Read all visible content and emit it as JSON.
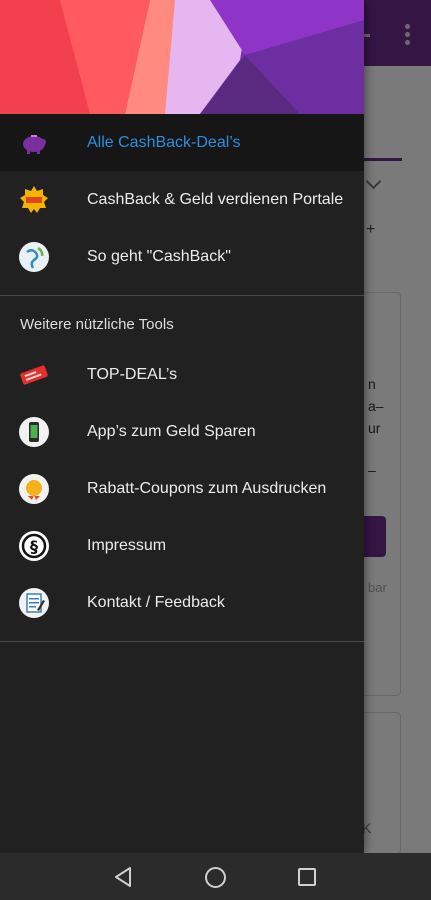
{
  "drawer": {
    "items_primary": [
      {
        "label": "Alle CashBack-Deal’s",
        "icon": "piggy-bank-icon",
        "active": true
      },
      {
        "label": "CashBack & Geld verdienen Portale",
        "icon": "new-badge-icon",
        "active": false
      },
      {
        "label": "So geht \"CashBack\"",
        "icon": "globe-icon",
        "active": false
      }
    ],
    "section_title": "Weitere nützliche Tools",
    "items_tools": [
      {
        "label": "TOP-DEAL’s",
        "icon": "ticket-icon"
      },
      {
        "label": "App’s zum Geld Sparen",
        "icon": "smartphone-icon"
      },
      {
        "label": "Rabatt-Coupons zum Ausdrucken",
        "icon": "coupon-icon"
      },
      {
        "label": "Impressum",
        "icon": "paragraph-icon"
      },
      {
        "label": "Kontakt / Feedback",
        "icon": "notepad-icon"
      }
    ]
  },
  "background": {
    "peek_texts": [
      "n",
      "a–",
      "ur",
      "–"
    ],
    "peek_dim": "bar",
    "peek_close": "K"
  },
  "colors": {
    "drawer_bg": "#212121",
    "active_text": "#2b8fe0",
    "toolbar": "#6f2d8e"
  },
  "navbar": {
    "back": "back-icon",
    "home": "home-icon",
    "recents": "recents-icon"
  }
}
